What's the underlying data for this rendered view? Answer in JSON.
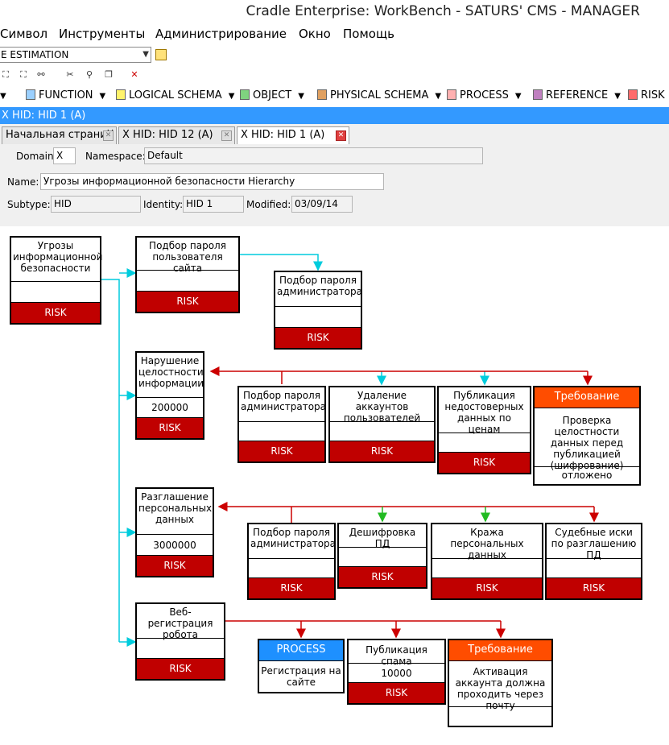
{
  "window": {
    "title": "Cradle Enterprise: WorkBench - SATURS' CMS - MANAGER"
  },
  "menu": [
    "Символ",
    "Инструменты",
    "Администрирование",
    "Окно",
    "Помощь"
  ],
  "combo": {
    "value": "E ESTIMATION"
  },
  "toolbar_types": [
    {
      "label": "FUNCTION",
      "icon": "function-icon"
    },
    {
      "label": "LOGICAL SCHEMA",
      "icon": "logical-schema-icon"
    },
    {
      "label": "OBJECT",
      "icon": "object-icon"
    },
    {
      "label": "PHYSICAL SCHEMA",
      "icon": "physical-schema-icon"
    },
    {
      "label": "PROCESS",
      "icon": "process-icon"
    },
    {
      "label": "REFERENCE",
      "icon": "reference-icon"
    },
    {
      "label": "RISK",
      "icon": "risk-icon"
    }
  ],
  "bluebar": "X HID: HID 1 (A)",
  "tabs": [
    {
      "label": "Начальная страниЧ"
    },
    {
      "label": "X HID: HID 12 (A)"
    },
    {
      "label": "X HID: HID 1 (A)"
    }
  ],
  "form": {
    "domain_label": "Domain",
    "domain_value": "X",
    "namespace_label": "Namespace:",
    "namespace_value": "Default",
    "name_label": "Name:",
    "name_value": "Угрозы информационной безопасности Hierarchy",
    "subtype_label": "Subtype:",
    "subtype_value": "HID",
    "identity_label": "Identity:",
    "identity_value": "HID 1",
    "modified_label": "Modified:",
    "modified_value": "03/09/14"
  },
  "nodes": {
    "root": {
      "title": "Угрозы информационной безопасности",
      "value": "",
      "risk": "RISK"
    },
    "n1": {
      "title": "Подбор пароля пользователя сайта",
      "value": "",
      "risk": "RISK"
    },
    "n1a": {
      "title": "Подбор пароля администратора",
      "value": "",
      "risk": "RISK"
    },
    "n2": {
      "title": "Нарушение целостности информации",
      "value": "200000",
      "risk": "RISK"
    },
    "n2a": {
      "title": "Подбор пароля администратора",
      "value": "",
      "risk": "RISK"
    },
    "n2b": {
      "title": "Удаление аккаунтов пользователей",
      "value": "",
      "risk": "RISK"
    },
    "n2c": {
      "title": "Публикация недостоверных данных по ценам",
      "value": "",
      "risk": "RISK"
    },
    "n2d": {
      "header": "Требование",
      "title": "Проверка целостности данных перед публикацией (шифрование)",
      "value": "отложено"
    },
    "n3": {
      "title": "Разглашение персональных данных",
      "value": "3000000",
      "risk": "RISK"
    },
    "n3a": {
      "title": "Подбор пароля администратора",
      "value": "",
      "risk": "RISK"
    },
    "n3b": {
      "title": "Дешифровка ПД",
      "value": "",
      "risk": "RISK"
    },
    "n3c": {
      "title": "Кража персональных данных",
      "value": "",
      "risk": "RISK"
    },
    "n3d": {
      "title": "Судебные иски по разглашению ПД",
      "value": "",
      "risk": "RISK"
    },
    "n4": {
      "title": "Веб-регистрация робота",
      "value": "",
      "risk": "RISK"
    },
    "n4a": {
      "header": "PROCESS",
      "title": "Регистрация на сайте"
    },
    "n4b": {
      "title": "Публикация спама",
      "value": "10000",
      "risk": "RISK"
    },
    "n4c": {
      "header": "Требование",
      "title": "Активация аккаунта должна проходить через почту",
      "value": ""
    }
  },
  "colors": {
    "risk": "#c00000",
    "requirement": "#ff4d00",
    "process": "#1e90ff",
    "link_cyan": "#00ccdd",
    "link_red": "#cc0000",
    "link_green": "#22bb22",
    "selection": "#3399ff"
  }
}
